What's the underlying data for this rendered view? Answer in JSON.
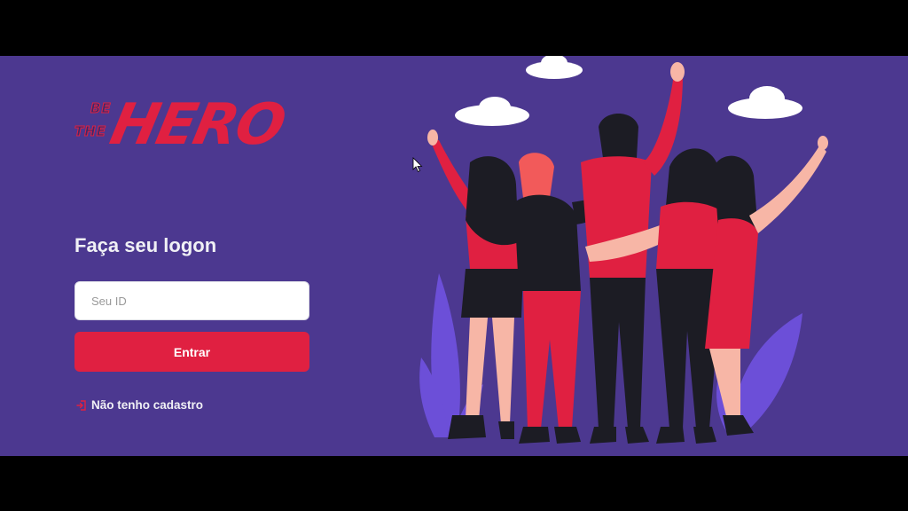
{
  "brand": {
    "logo_line1": "BE",
    "logo_line2": "THE",
    "logo_main": "HERO",
    "colors": {
      "accent": "#e02041",
      "background": "#4c3890",
      "text": "#f0f0f5"
    }
  },
  "logon": {
    "title": "Faça seu logon",
    "id_input": {
      "placeholder": "Seu ID",
      "value": ""
    },
    "submit_label": "Entrar",
    "register_link_label": "Não tenho cadastro",
    "register_icon": "log-in-icon"
  },
  "illustration": {
    "icon": "heroes-group-illustration"
  }
}
